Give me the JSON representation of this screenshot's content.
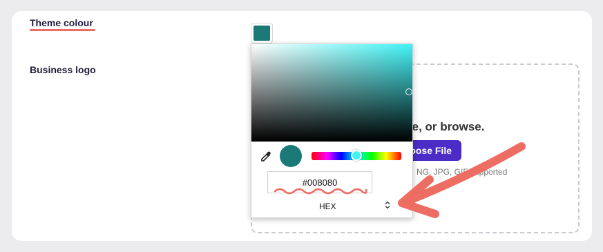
{
  "form": {
    "theme_label": "Theme colour",
    "logo_label": "Business logo"
  },
  "theme_color": "#1b7a78",
  "dropzone": {
    "heading_partial": "re, or browse.",
    "button_partial": "oose File",
    "note_partial": "NG, JPG, GIF supported"
  },
  "picker": {
    "hex_value": "#008080",
    "format": "HEX",
    "format_chevron": "⌃⌄",
    "hue_handle_color": "#40f3f6",
    "saturation_base": "#40f3f6"
  },
  "annotation": {
    "color": "#ee6d63"
  }
}
